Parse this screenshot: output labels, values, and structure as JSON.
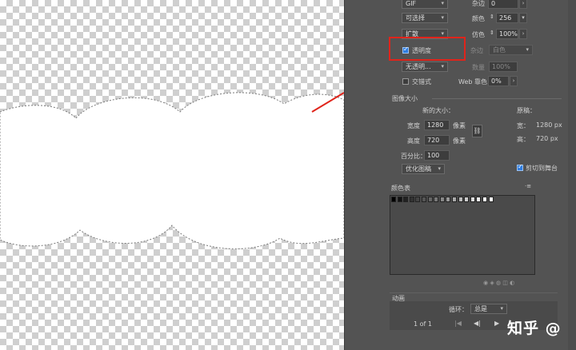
{
  "top": {
    "format_value": "GIF",
    "bleed_label": "杂边",
    "bleed_value": "0",
    "reduction_value": "可选择",
    "colors_label": "颜色",
    "colors_value": "256",
    "dither_method_value": "扩散",
    "dither_label": "仿色",
    "dither_value": "100%"
  },
  "transparency": {
    "checkbox_label": "透明度",
    "checked": true,
    "matte_label": "杂边",
    "matte_value": "白色",
    "trans_dither_value": "无透明...",
    "amount_label": "数量",
    "amount_value": "100%"
  },
  "interlace": {
    "label": "交错式",
    "web_snap_label": "Web 靠色",
    "web_snap_value": "0%"
  },
  "image_size": {
    "section_title": "图像大小",
    "new_size_label": "新的大小：",
    "original_label": "原稿：",
    "width_label": "宽度",
    "width_value": "1280",
    "height_label": "高度",
    "height_value": "720",
    "unit_label": "像素",
    "percent_label": "百分比：",
    "percent_value": "100",
    "orig_width_label": "宽：",
    "orig_width_value": "1280 px",
    "orig_height_label": "高：",
    "orig_height_value": "720 px",
    "quality_value": "优化图稿",
    "clip_label": "剪切到舞台",
    "clip_checked": true
  },
  "color_table": {
    "title": "颜色表",
    "swatches": [
      "#000000",
      "#111111",
      "#222222",
      "#333333",
      "#444444",
      "#555555",
      "#666666",
      "#777777",
      "#888888",
      "#999999",
      "#aaaaaa",
      "#bbbbbb",
      "#cccccc",
      "#dddddd",
      "#eeeeee",
      "#ffffff",
      "#ffffff"
    ]
  },
  "animation": {
    "title": "动画",
    "loop_label": "循环：",
    "loop_value": "总是",
    "frame_counter": "1 of 1"
  },
  "watermark": "知乎 @"
}
